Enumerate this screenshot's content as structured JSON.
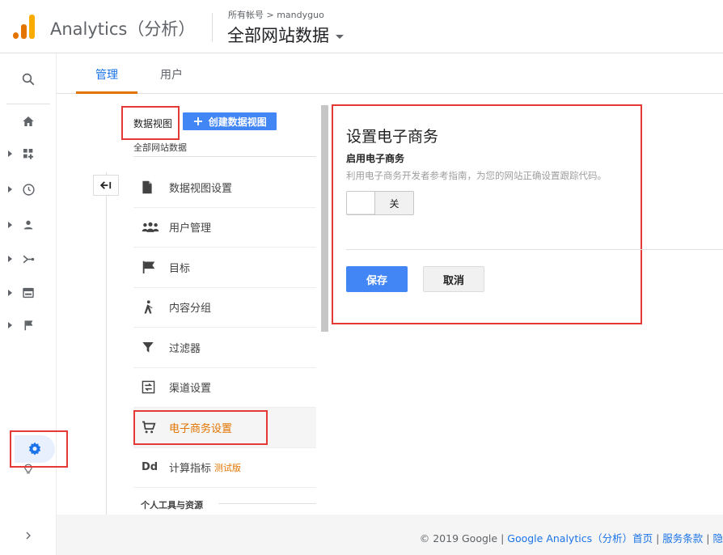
{
  "header": {
    "app_title": "Analytics（分析）",
    "breadcrumb": "所有帐号 > mandyguo",
    "property": "全部网站数据"
  },
  "tabs": [
    {
      "label": "管理",
      "active": true
    },
    {
      "label": "用户",
      "active": false
    }
  ],
  "view": {
    "column_label": "数据视图",
    "create_button": "创建数据视图",
    "current_view": "全部网站数据"
  },
  "menu": [
    {
      "label": "数据视图设置",
      "icon": "document-icon"
    },
    {
      "label": "用户管理",
      "icon": "people-icon"
    },
    {
      "label": "目标",
      "icon": "flag-icon"
    },
    {
      "label": "内容分组",
      "icon": "walk-icon"
    },
    {
      "label": "过滤器",
      "icon": "filter-icon"
    },
    {
      "label": "渠道设置",
      "icon": "channel-icon"
    },
    {
      "label": "电子商务设置",
      "icon": "cart-icon",
      "active": true
    },
    {
      "label": "计算指标",
      "icon": "dd-icon",
      "icon_text": "Dd",
      "badge": "测试版"
    }
  ],
  "personal_section": "个人工具与资源",
  "panel": {
    "title": "设置电子商务",
    "enable_label": "启用电子商务",
    "help_text": "利用电子商务开发者参考指南，为您的网站正确设置跟踪代码。",
    "toggle_state": "关",
    "save_label": "保存",
    "cancel_label": "取消"
  },
  "footer": {
    "copyright": "© 2019 Google",
    "links": [
      "Google Analytics（分析）首页",
      "服务条款",
      "隐"
    ]
  },
  "colors": {
    "accent_blue": "#4285f4",
    "link_blue": "#1a73e8",
    "orange": "#e37400",
    "highlight_red": "#e53935"
  }
}
